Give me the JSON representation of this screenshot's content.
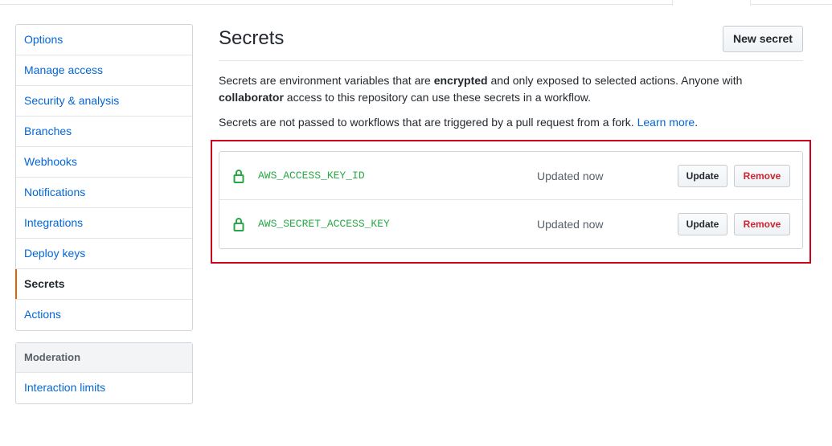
{
  "sidebar": {
    "items": [
      {
        "label": "Options",
        "selected": false
      },
      {
        "label": "Manage access",
        "selected": false
      },
      {
        "label": "Security & analysis",
        "selected": false
      },
      {
        "label": "Branches",
        "selected": false
      },
      {
        "label": "Webhooks",
        "selected": false
      },
      {
        "label": "Notifications",
        "selected": false
      },
      {
        "label": "Integrations",
        "selected": false
      },
      {
        "label": "Deploy keys",
        "selected": false
      },
      {
        "label": "Secrets",
        "selected": true
      },
      {
        "label": "Actions",
        "selected": false
      }
    ],
    "moderation": {
      "heading": "Moderation",
      "items": [
        {
          "label": "Interaction limits"
        }
      ]
    }
  },
  "main": {
    "title": "Secrets",
    "new_secret_label": "New secret",
    "desc1": {
      "part1": "Secrets are environment variables that are ",
      "bold1": "encrypted",
      "part2": " and only exposed to selected actions. Anyone with ",
      "bold2": "collaborator",
      "part3": " access to this repository can use these secrets in a workflow."
    },
    "desc2": {
      "text": "Secrets are not passed to workflows that are triggered by a pull request from a fork. ",
      "link": "Learn more",
      "end": "."
    },
    "secrets": [
      {
        "name": "AWS_ACCESS_KEY_ID",
        "status": "Updated now",
        "update_label": "Update",
        "remove_label": "Remove",
        "icon": "lock-icon"
      },
      {
        "name": "AWS_SECRET_ACCESS_KEY",
        "status": "Updated now",
        "update_label": "Update",
        "remove_label": "Remove",
        "icon": "lock-icon"
      }
    ]
  },
  "colors": {
    "link": "#0366d6",
    "secret_name": "#28a745",
    "remove": "#cb2431",
    "selected_marker": "#e36209",
    "highlight_border": "#d0021b"
  }
}
